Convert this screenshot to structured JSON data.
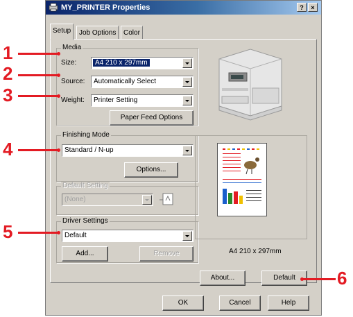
{
  "window": {
    "title": "MY_PRINTER Properties",
    "help_btn": "?",
    "close_btn": "×"
  },
  "tabs": [
    {
      "label": "Setup",
      "active": true
    },
    {
      "label": "Job Options",
      "active": false
    },
    {
      "label": "Color",
      "active": false
    }
  ],
  "media": {
    "group_label": "Media",
    "size_label": "Size:",
    "size_value": "A4 210 x 297mm",
    "source_label": "Source:",
    "source_value": "Automatically Select",
    "weight_label": "Weight:",
    "weight_value": "Printer Setting",
    "paper_feed_button": "Paper Feed Options"
  },
  "finishing": {
    "group_label": "Finishing Mode",
    "value": "Standard / N-up",
    "options_button": "Options..."
  },
  "default_setting": {
    "group_label": "Default Setting",
    "value": "(None)"
  },
  "driver": {
    "group_label": "Driver Settings",
    "value": "Default",
    "add_button": "Add...",
    "remove_button": "Remove"
  },
  "preview": {
    "caption": "A4 210 x 297mm"
  },
  "bottom": {
    "about_button": "About...",
    "default_button": "Default",
    "ok_button": "OK",
    "cancel_button": "Cancel",
    "help_button": "Help"
  },
  "callouts": [
    "1",
    "2",
    "3",
    "4",
    "5",
    "6"
  ],
  "colors": {
    "callout": "#e31b23",
    "title_start": "#0a246a",
    "title_end": "#a6caf0",
    "dialog_bg": "#d4d0c8"
  }
}
